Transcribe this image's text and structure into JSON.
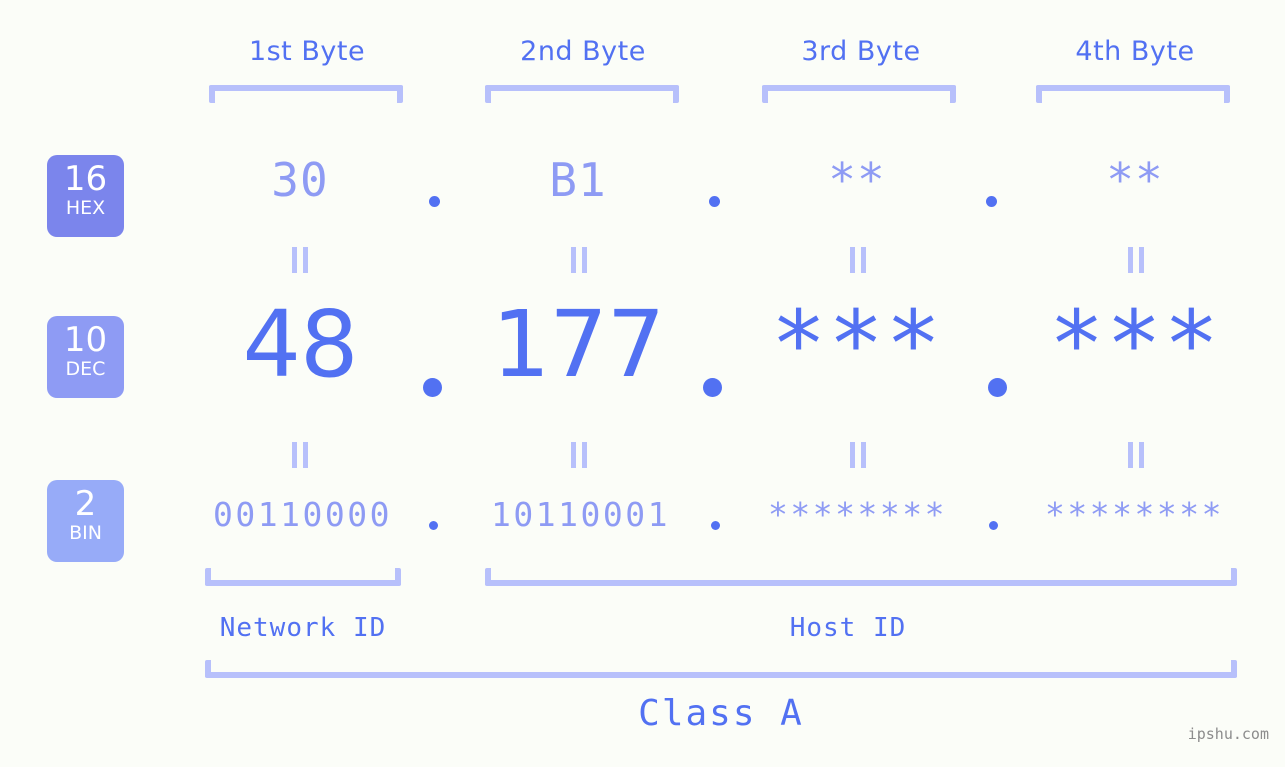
{
  "watermark": "ipshu.com",
  "byte_headers": [
    {
      "label": "1st Byte"
    },
    {
      "label": "2nd Byte"
    },
    {
      "label": "3rd Byte"
    },
    {
      "label": "4th Byte"
    }
  ],
  "bases": [
    {
      "num": "16",
      "name": "HEX",
      "color": "#7b85ec"
    },
    {
      "num": "10",
      "name": "DEC",
      "color": "#8e9bf4"
    },
    {
      "num": "2",
      "name": "BIN",
      "color": "#97abf8"
    }
  ],
  "rows": {
    "hex": {
      "values": [
        "30",
        "B1",
        "**",
        "**"
      ]
    },
    "dec": {
      "values": [
        "48",
        "177",
        "***",
        "***"
      ]
    },
    "bin": {
      "values": [
        "00110000",
        "10110001",
        "********",
        "********"
      ]
    }
  },
  "separator": ".",
  "equals_mark": "=",
  "segments": [
    {
      "label": "Network ID"
    },
    {
      "label": "Host ID"
    }
  ],
  "class": {
    "label": "Class A"
  },
  "colors": {
    "background": "#fbfdf8",
    "accent_strong": "#5271f2",
    "accent_mid": "#8e9bf4",
    "accent_light": "#b7c0fb"
  }
}
